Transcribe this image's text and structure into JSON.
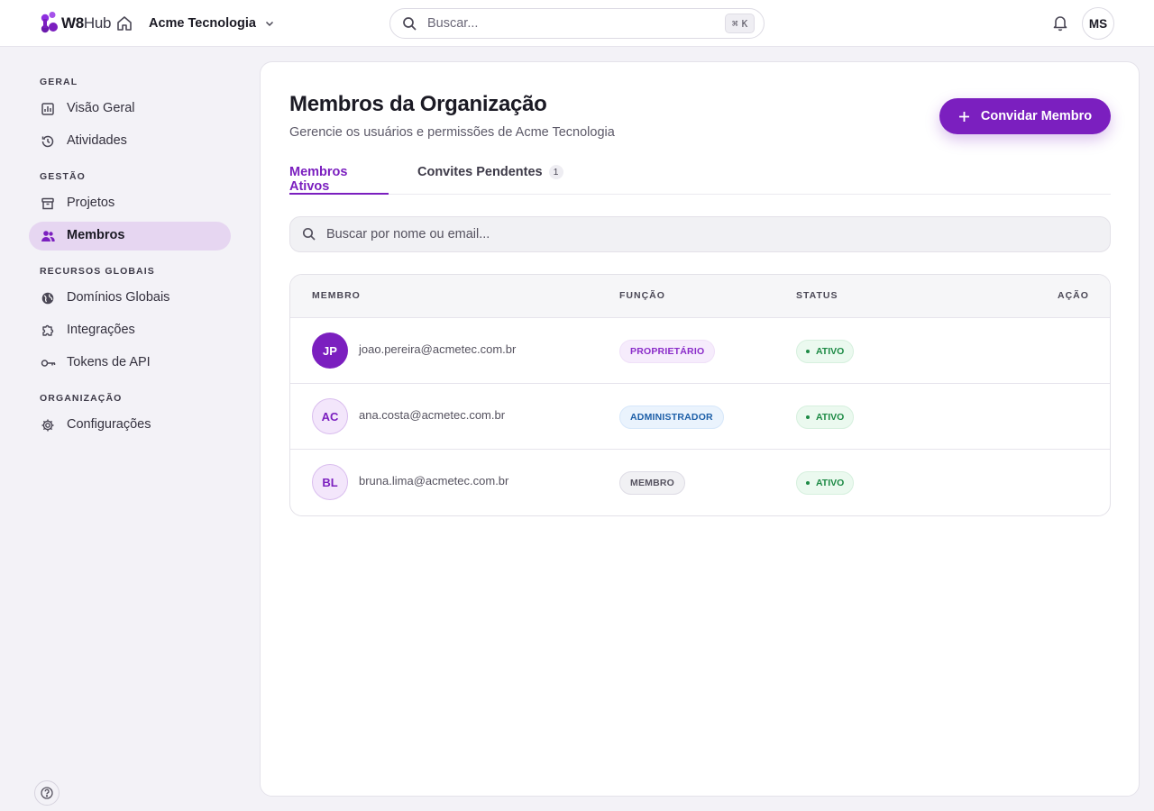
{
  "topbar": {
    "logo_bold": "W8",
    "logo_light": "Hub",
    "org_name": "Acme Tecnologia",
    "search_placeholder": "Buscar...",
    "shortcut_symbol": "⌘",
    "shortcut_key": "K",
    "user_initials": "MS"
  },
  "sidebar": {
    "sections": [
      {
        "title": "GERAL",
        "items": [
          {
            "label": "Visão Geral",
            "icon": "chart-icon"
          },
          {
            "label": "Atividades",
            "icon": "history-icon"
          }
        ]
      },
      {
        "title": "GESTÃO",
        "items": [
          {
            "label": "Projetos",
            "icon": "archive-icon"
          },
          {
            "label": "Membros",
            "icon": "users-icon",
            "active": true
          }
        ]
      },
      {
        "title": "RECURSOS GLOBAIS",
        "items": [
          {
            "label": "Domínios Globais",
            "icon": "globe-icon"
          },
          {
            "label": "Integrações",
            "icon": "puzzle-icon"
          },
          {
            "label": "Tokens de API",
            "icon": "key-icon"
          }
        ]
      },
      {
        "title": "ORGANIZAÇÃO",
        "items": [
          {
            "label": "Configurações",
            "icon": "gear-icon"
          }
        ]
      }
    ]
  },
  "main": {
    "title": "Membros da Organização",
    "subtitle": "Gerencie os usuários e permissões de Acme Tecnologia",
    "invite_label": "Convidar Membro",
    "tabs": [
      {
        "label": "Membros Ativos",
        "active": true
      },
      {
        "label": "Convites Pendentes",
        "count": "1"
      }
    ],
    "search_placeholder": "Buscar por nome ou email...",
    "table": {
      "headers": [
        "MEMBRO",
        "FUNÇÃO",
        "STATUS",
        "AÇÃO"
      ],
      "rows": [
        {
          "initials": "JP",
          "email": "joao.pereira@acmetec.com.br",
          "role": "PROPRIETÁRIO",
          "status": "ATIVO"
        },
        {
          "initials": "AC",
          "email": "ana.costa@acmetec.com.br",
          "role": "ADMINISTRADOR",
          "status": "ATIVO"
        },
        {
          "initials": "BL",
          "email": "bruna.lima@acmetec.com.br",
          "role": "MEMBRO",
          "status": "ATIVO"
        }
      ]
    }
  },
  "colors": {
    "brand": "#7b1fbf",
    "active_nav_bg": "#e6d6f1",
    "status_green": "#1d8a45",
    "admin_blue": "#1d5fa8"
  }
}
